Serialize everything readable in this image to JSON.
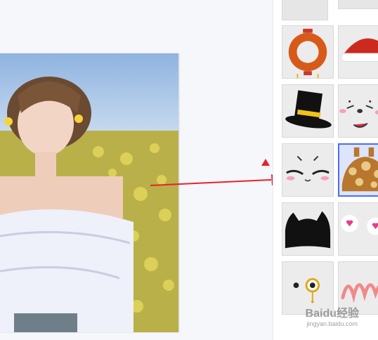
{
  "stickers": [
    {
      "icon": "lantern-ring-icon"
    },
    {
      "icon": "santa-hat-icon"
    },
    {
      "icon": "top-hat-icon"
    },
    {
      "icon": "cute-face-icon"
    },
    {
      "icon": "squint-eyes-icon"
    },
    {
      "icon": "giraffe-hat-icon",
      "selected": true
    },
    {
      "icon": "cat-ears-icon"
    },
    {
      "icon": "sparkle-eyes-icon"
    },
    {
      "icon": "monocle-eyes-icon"
    },
    {
      "icon": "pink-scribble-icon"
    }
  ],
  "watermark": {
    "brand": "Baidu经验",
    "domain": "jingyan.baidu.com"
  },
  "colors": {
    "accent": "#4a6cf7",
    "arrow": "#e8222b"
  }
}
